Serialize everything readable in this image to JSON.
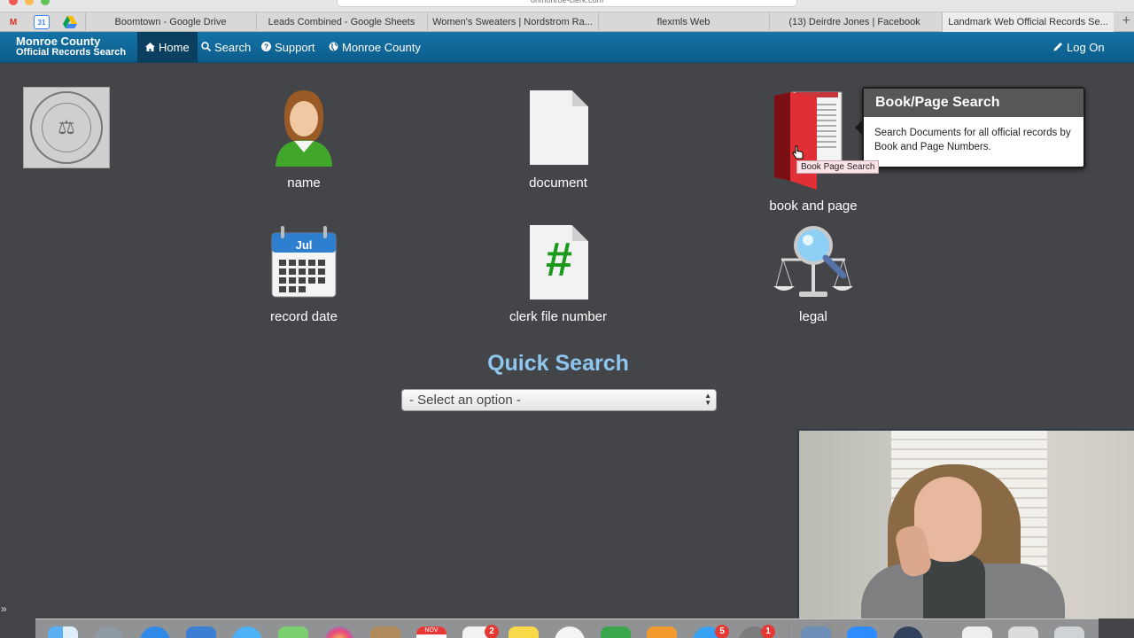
{
  "browser": {
    "url_partial": "onmonroe-clerk.com",
    "tabs": [
      {
        "label": "Boomtown - Google Drive"
      },
      {
        "label": "Leads Combined - Google Sheets"
      },
      {
        "label": "Women's Sweaters | Nordstrom Ra..."
      },
      {
        "label": "flexmls Web"
      },
      {
        "label": "(13) Deirdre Jones | Facebook"
      },
      {
        "label": "Landmark Web Official Records Se..."
      }
    ],
    "pinned_calendar_day": "31",
    "new_tab_glyph": "+"
  },
  "nav": {
    "brand_line1": "Monroe County",
    "brand_line2": "Official Records Search",
    "home": "Home",
    "search": "Search",
    "support": "Support",
    "county": "Monroe County",
    "logon": "Log On"
  },
  "tiles": {
    "name": "name",
    "document": "document",
    "book_and_page": "book and page",
    "record_date": "record date",
    "clerk_file_number": "clerk file number",
    "legal": "legal",
    "calendar_month": "Jul",
    "hash_glyph": "#"
  },
  "tooltip": {
    "title": "Book/Page Search",
    "body": "Search Documents for all official records by Book and Page Numbers.",
    "mini": "Book Page Search"
  },
  "quick_search": {
    "title": "Quick Search",
    "selected": "- Select an option -"
  },
  "dock": {
    "badges": [
      "2",
      "5",
      "1"
    ],
    "calendar_month": "NOV"
  },
  "icons": {
    "seal": "county-seal-icon",
    "person": "person-icon",
    "document": "document-icon",
    "book": "book-icon",
    "calendar": "calendar-icon",
    "hash_document": "hash-document-icon",
    "scales": "scales-of-justice-icon"
  },
  "colors": {
    "navbar": "#0c5c8a",
    "background": "#434549",
    "quick_search_title": "#8fc6ee",
    "book_red": "#d8242b"
  }
}
